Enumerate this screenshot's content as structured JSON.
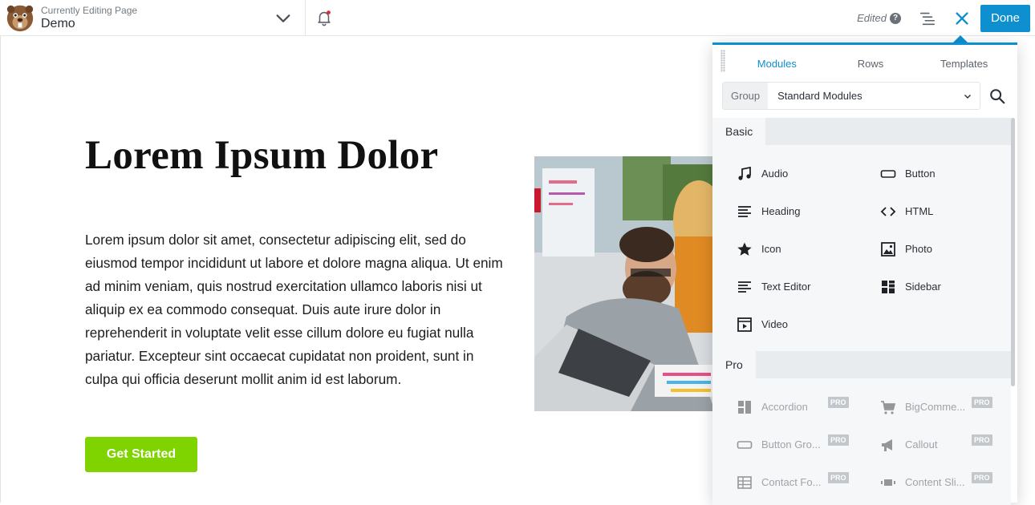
{
  "header": {
    "subtitle": "Currently Editing Page",
    "page_name": "Demo",
    "status": "Edited",
    "help_glyph": "?",
    "done_label": "Done"
  },
  "content": {
    "title": "Lorem Ipsum Dolor",
    "body": "Lorem ipsum dolor sit amet, consectetur adipiscing elit, sed do eiusmod tempor incididunt ut labore et dolore magna aliqua. Ut enim ad minim veniam, quis nostrud exercitation ullamco laboris nisi ut aliquip ex ea commodo consequat. Duis aute irure dolor in reprehenderit in voluptate velit esse cillum dolore eu fugiat nulla pariatur. Excepteur sint occaecat cupidatat non proident, sunt in culpa qui officia deserunt mollit anim id est laborum.",
    "cta_label": "Get Started"
  },
  "panel": {
    "tabs": [
      "Modules",
      "Rows",
      "Templates"
    ],
    "group_label": "Group",
    "group_value": "Standard Modules",
    "sections": [
      {
        "name": "Basic",
        "items": [
          {
            "label": "Audio",
            "icon": "music-note-icon"
          },
          {
            "label": "Button",
            "icon": "button-icon"
          },
          {
            "label": "Heading",
            "icon": "heading-icon"
          },
          {
            "label": "HTML",
            "icon": "code-icon"
          },
          {
            "label": "Icon",
            "icon": "star-icon"
          },
          {
            "label": "Photo",
            "icon": "photo-icon"
          },
          {
            "label": "Text Editor",
            "icon": "text-editor-icon"
          },
          {
            "label": "Sidebar",
            "icon": "sidebar-icon"
          },
          {
            "label": "Video",
            "icon": "video-icon"
          }
        ]
      },
      {
        "name": "Pro",
        "badge": "PRO",
        "items": [
          {
            "label": "Accordion",
            "icon": "accordion-icon"
          },
          {
            "label": "BigComme...",
            "icon": "cart-icon"
          },
          {
            "label": "Button Gro...",
            "icon": "button-icon"
          },
          {
            "label": "Callout",
            "icon": "megaphone-icon"
          },
          {
            "label": "Contact Fo...",
            "icon": "table-icon"
          },
          {
            "label": "Content Sli...",
            "icon": "slider-icon"
          }
        ]
      }
    ]
  },
  "colors": {
    "accent": "#0e8fd0",
    "cta": "#7fd400"
  }
}
